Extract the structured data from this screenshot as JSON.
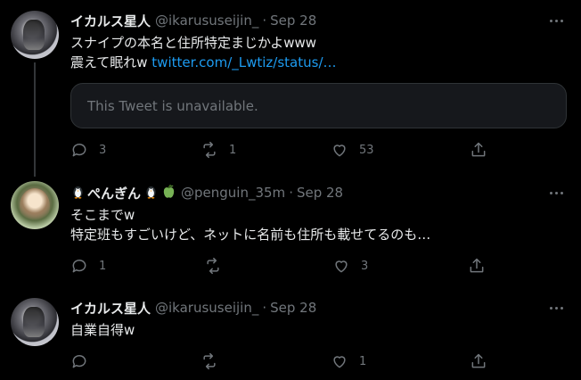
{
  "tweets": [
    {
      "name": "イカルス星人",
      "handle": "@ikarususeijin_",
      "date": "Sep 28",
      "line1": "スナイプの本名と住所特定まじかよwww",
      "line2_text": "震えて眠れw ",
      "line2_link": "twitter.com/_Lwtiz/status/…",
      "quote_text": "This Tweet is unavailable.",
      "replies": "3",
      "retweets": "1",
      "likes": "53"
    },
    {
      "name": "ぺんぎん",
      "handle": "@penguin_35m",
      "date": "Sep 28",
      "line1": "そこまでw",
      "line2": "特定班もすごいけど、ネットに名前も住所も載せてるのも…",
      "replies": "1",
      "retweets": "",
      "likes": "3"
    },
    {
      "name": "イカルス星人",
      "handle": "@ikarususeijin_",
      "date": "Sep 28",
      "line1": "自業自得w",
      "replies": "",
      "retweets": "",
      "likes": "1"
    }
  ],
  "separator": "·",
  "icons": [
    "reply-icon",
    "retweet-icon",
    "like-icon",
    "share-icon",
    "more-icon",
    "penguin-emoji",
    "green-apple-emoji"
  ]
}
